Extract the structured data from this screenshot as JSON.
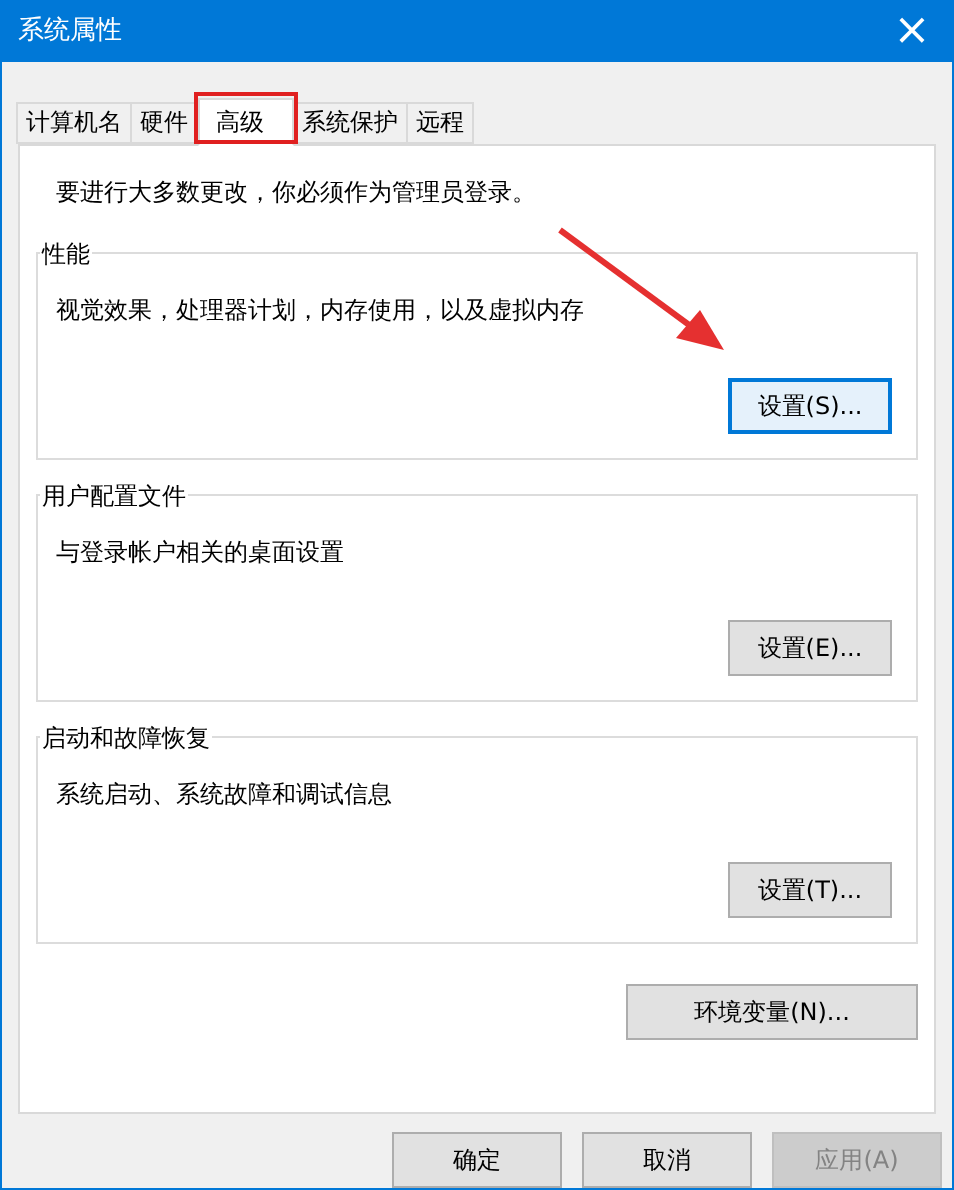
{
  "window": {
    "title": "系统属性",
    "close": "×"
  },
  "tabs": [
    {
      "label": "计算机名",
      "selected": false
    },
    {
      "label": "硬件",
      "selected": false
    },
    {
      "label": "高级",
      "selected": true
    },
    {
      "label": "系统保护",
      "selected": false
    },
    {
      "label": "远程",
      "selected": false
    }
  ],
  "notice": "要进行大多数更改，你必须作为管理员登录。",
  "groups": [
    {
      "title": "性能",
      "description": "视觉效果，处理器计划，内存使用，以及虚拟内存",
      "button": {
        "label": "设置(S)...",
        "focused": true
      }
    },
    {
      "title": "用户配置文件",
      "description": "与登录帐户相关的桌面设置",
      "button": {
        "label": "设置(E)...",
        "focused": false
      }
    },
    {
      "title": "启动和故障恢复",
      "description": "系统启动、系统故障和调试信息",
      "button": {
        "label": "设置(T)...",
        "focused": false
      }
    }
  ],
  "env_button": "环境变量(N)...",
  "buttons": [
    {
      "label": "确定",
      "disabled": false
    },
    {
      "label": "取消",
      "disabled": false
    },
    {
      "label": "应用(A)",
      "disabled": true
    }
  ]
}
